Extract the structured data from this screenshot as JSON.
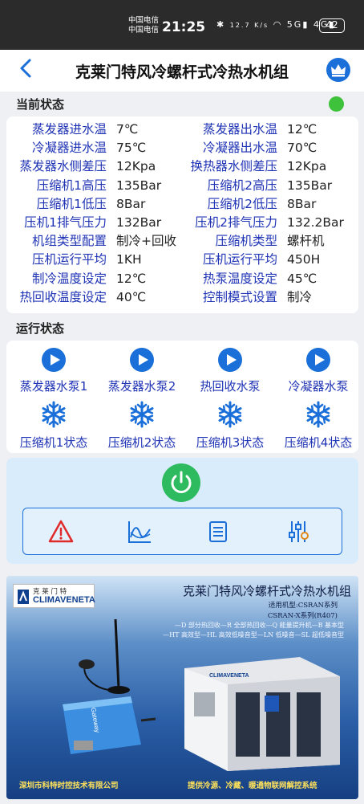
{
  "status_bar": {
    "carrier1": "中国电信",
    "carrier2": "中国电信",
    "time": "21:25",
    "net_speed": "12.7 K/s",
    "battery": "42"
  },
  "header": {
    "title": "克莱门特风冷螺杆式冷热水机组",
    "back_icon": "chevron-left-icon",
    "crown_icon": "crown-icon"
  },
  "current_status": {
    "label": "当前状态",
    "indicator_color": "#3ec13b",
    "rows": [
      {
        "l1": "蒸发器进水温",
        "v1": "7℃",
        "l2": "蒸发器出水温",
        "v2": "12℃"
      },
      {
        "l1": "冷凝器进水温",
        "v1": "75℃",
        "l2": "冷凝器出水温",
        "v2": "70℃"
      },
      {
        "l1": "蒸发器水侧差压",
        "v1": "12Kpa",
        "l2": "换热器水侧差压",
        "v2": "12Kpa"
      },
      {
        "l1": "压缩机1高压",
        "v1": "135Bar",
        "l2": "压缩机2高压",
        "v2": "135Bar"
      },
      {
        "l1": "压缩机1低压",
        "v1": "8Bar",
        "l2": "压缩机2低压",
        "v2": "8Bar"
      },
      {
        "l1": "压机1排气压力",
        "v1": "132Bar",
        "l2": "压机2排气压力",
        "v2": "132.2Bar"
      },
      {
        "l1": "机组类型配置",
        "v1": "制冷+回收",
        "l2": "压缩机类型",
        "v2": "螺杆机"
      },
      {
        "l1": "压机运行平均",
        "v1": "1KH",
        "l2": "压机运行平均",
        "v2": "450H"
      },
      {
        "l1": "制冷温度设定",
        "v1": "12℃",
        "l2": "热泵温度设定",
        "v2": "45℃"
      },
      {
        "l1": "热回收温度设定",
        "v1": "40℃",
        "l2": "控制模式设置",
        "v2": "制冷"
      }
    ]
  },
  "run_status": {
    "label": "运行状态",
    "pumps": [
      "蒸发器水泵1",
      "蒸发器水泵2",
      "热回收水泵",
      "冷凝器水泵"
    ],
    "compressors": [
      "压缩机1状态",
      "压缩机2状态",
      "压缩机3状态",
      "压缩机4状态"
    ],
    "pump_icon": "play-icon",
    "compressor_icon": "snowflake-icon",
    "accent_color": "#1a6fd9"
  },
  "controls": {
    "power_icon": "power-icon",
    "tools": [
      "alarm-icon",
      "chart-icon",
      "list-icon",
      "settings-sliders-icon"
    ]
  },
  "banner": {
    "logo_cn": "克 莱 门 特",
    "logo_en": "CLIMAVENETA",
    "title": "克莱门特风冷螺杆式冷热水机组",
    "subtitle1": "适用机型:CSRAN系列",
    "subtitle2": "CSRAN-X系列(R407)",
    "line1": "—D 部分热回收—R 全部热回收—Q 能量提升机—B 基本型",
    "line2": "—HT 高效型—HL 高效低噪音型—LN 低噪音—SL 超低噪音型",
    "device_label": "Gateway",
    "unit_label": "CLIMAVENETA",
    "company": "深圳市科特时控技术有限公司",
    "slogan": "提供冷源、冷藏、暖通物联网解控系统"
  }
}
